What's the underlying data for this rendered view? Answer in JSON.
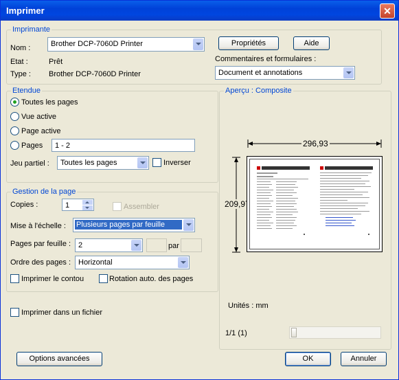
{
  "window": {
    "title": "Imprimer"
  },
  "printer": {
    "legend": "Imprimante",
    "name_label": "Nom :",
    "name_value": "Brother DCP-7060D Printer",
    "properties_button": "Propriétés",
    "help_button": "Aide",
    "status_label": "Etat :",
    "status_value": "Prêt",
    "type_label": "Type :",
    "type_value": "Brother DCP-7060D Printer",
    "comments_label": "Commentaires et formulaires :",
    "comments_value": "Document et annotations"
  },
  "range": {
    "legend": "Etendue",
    "all_pages": "Toutes les pages",
    "current_view": "Vue active",
    "current_page": "Page active",
    "pages": "Pages",
    "pages_value": "1 - 2",
    "subset_label": "Jeu partiel :",
    "subset_value": "Toutes les pages",
    "reverse": "Inverser",
    "selected": "Toutes les pages"
  },
  "handling": {
    "legend": "Gestion de la page",
    "copies_label": "Copies :",
    "copies_value": "1",
    "collate": "Assembler",
    "scaling_label": "Mise à l'échelle :",
    "scaling_value": "Plusieurs pages par feuille",
    "pps_label": "Pages par feuille :",
    "pps_value": "2",
    "by_label": "par",
    "order_label": "Ordre des pages :",
    "order_value": "Horizontal",
    "print_border": "Imprimer le contou",
    "auto_rotate": "Rotation auto. des pages"
  },
  "print_to_file": "Imprimer dans un fichier",
  "preview": {
    "legend": "Aperçu : Composite",
    "width": "296,93",
    "height": "209,97",
    "units": "Unités : mm",
    "page_counter": "1/1 (1)"
  },
  "buttons": {
    "advanced": "Options avancées",
    "ok": "OK",
    "cancel": "Annuler"
  }
}
